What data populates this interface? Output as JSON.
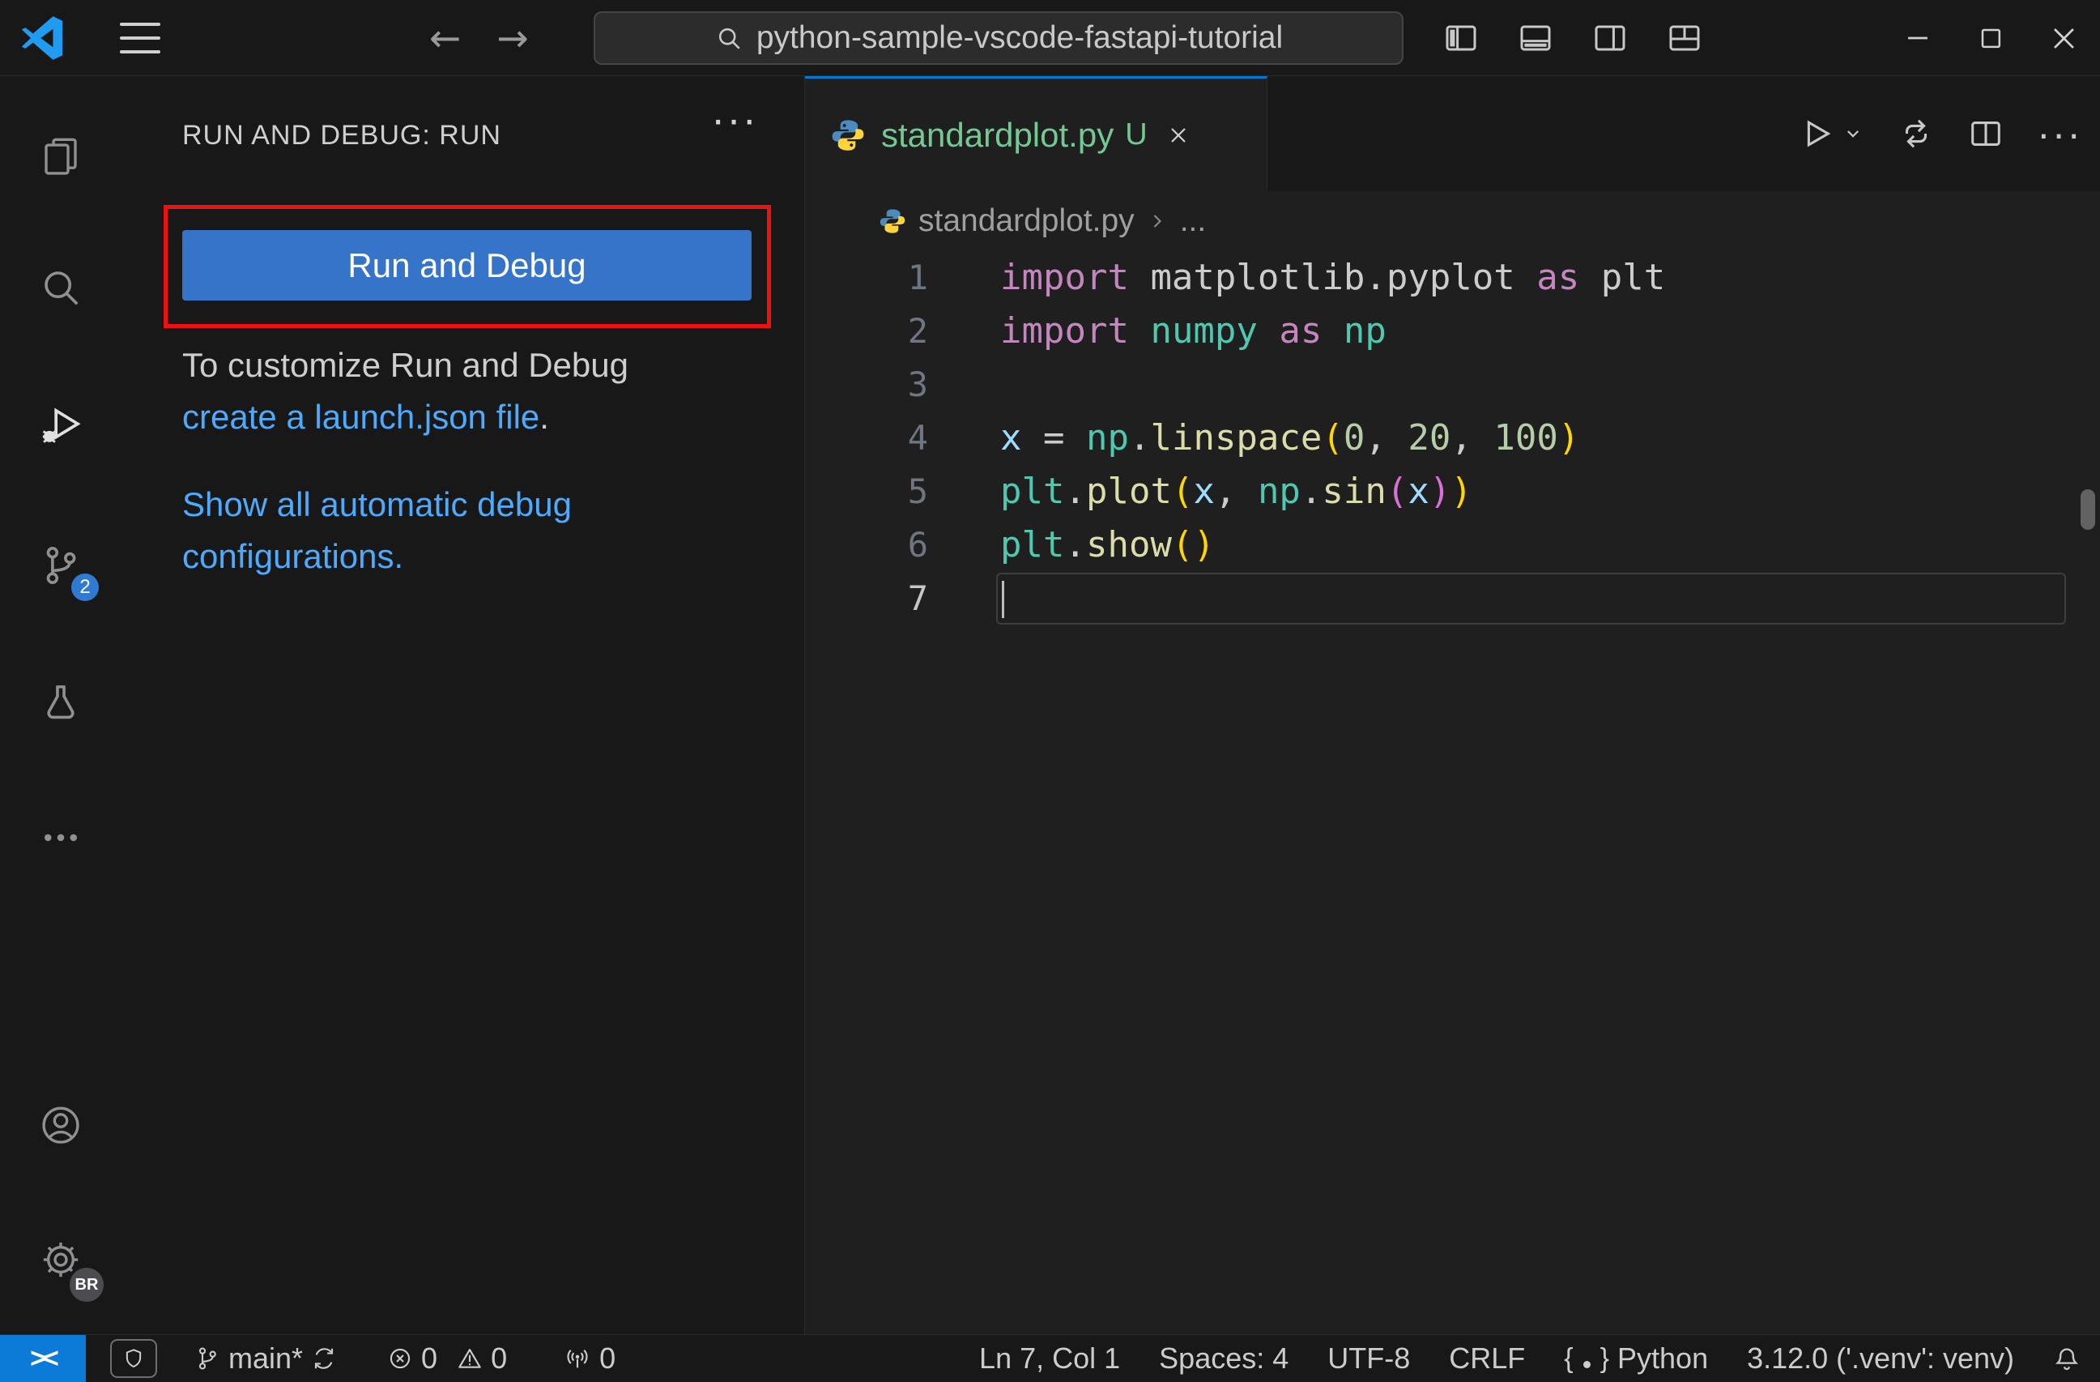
{
  "titlebar": {
    "search_text": "python-sample-vscode-fastapi-tutorial"
  },
  "icons": {
    "back": "←",
    "forward": "→",
    "more_dots": "···",
    "ellipsis": "···",
    "brace_open": "{",
    "brace_close": "}"
  },
  "activity_bar": {
    "scm_badge": "2",
    "profile_badge": "BR"
  },
  "sidebar": {
    "title": "RUN AND DEBUG: RUN",
    "run_button": "Run and Debug",
    "customize_prefix": "To customize Run and Debug ",
    "launch_link": "create a launch.json file",
    "customize_suffix": ".",
    "show_all_link": "Show all automatic debug configurations."
  },
  "editor": {
    "tab": {
      "name": "standardplot.py",
      "git_status": "U"
    },
    "breadcrumb": {
      "file": "standardplot.py",
      "more": "..."
    },
    "code_lines": [
      {
        "n": "1",
        "tokens": [
          [
            "import",
            "kw"
          ],
          [
            " matplotlib.pyplot ",
            "fg"
          ],
          [
            "as",
            "kw"
          ],
          [
            " plt",
            "fg"
          ]
        ]
      },
      {
        "n": "2",
        "tokens": [
          [
            "import",
            "kw"
          ],
          [
            " ",
            "fg"
          ],
          [
            "numpy",
            "mod"
          ],
          [
            " ",
            "fg"
          ],
          [
            "as",
            "kw"
          ],
          [
            " ",
            "fg"
          ],
          [
            "np",
            "mod"
          ]
        ]
      },
      {
        "n": "3",
        "tokens": []
      },
      {
        "n": "4",
        "tokens": [
          [
            "x",
            "var"
          ],
          [
            " = ",
            "fg"
          ],
          [
            "np",
            "mod"
          ],
          [
            ".",
            "fg"
          ],
          [
            "linspace",
            "fn"
          ],
          [
            "(",
            "b1"
          ],
          [
            "0",
            "num"
          ],
          [
            ", ",
            "fg"
          ],
          [
            "20",
            "num"
          ],
          [
            ", ",
            "fg"
          ],
          [
            "100",
            "num"
          ],
          [
            ")",
            "b1"
          ]
        ]
      },
      {
        "n": "5",
        "tokens": [
          [
            "plt",
            "mod"
          ],
          [
            ".",
            "fg"
          ],
          [
            "plot",
            "fn"
          ],
          [
            "(",
            "b1"
          ],
          [
            "x",
            "var"
          ],
          [
            ", ",
            "fg"
          ],
          [
            "np",
            "mod"
          ],
          [
            ".",
            "fg"
          ],
          [
            "sin",
            "fn"
          ],
          [
            "(",
            "b2"
          ],
          [
            "x",
            "var"
          ],
          [
            ")",
            "b2"
          ],
          [
            ")",
            "b1"
          ]
        ]
      },
      {
        "n": "6",
        "tokens": [
          [
            "plt",
            "mod"
          ],
          [
            ".",
            "fg"
          ],
          [
            "show",
            "fn"
          ],
          [
            "(",
            "b1"
          ],
          [
            ")",
            "b1"
          ]
        ]
      },
      {
        "n": "7",
        "tokens": [],
        "current": true
      }
    ]
  },
  "status_bar": {
    "remote_label": "><",
    "branch": "main*",
    "errors": "0",
    "warnings": "0",
    "ports": "0",
    "line_col": "Ln 7, Col 1",
    "spaces": "Spaces: 4",
    "encoding": "UTF-8",
    "eol": "CRLF",
    "language": "Python",
    "interpreter": "3.12.0 ('.venv': venv)"
  },
  "colors": {
    "chrome": "#181818",
    "editor": "#1f1f1f",
    "border": "#2b2b2b",
    "fg": "#cccccc",
    "accent": "#0078d4",
    "button": "#3574c9",
    "link": "#4daafc",
    "badge": "#2f7bd4",
    "remote": "#0c7bd8",
    "highlight_red": "#ee1111",
    "untracked_green": "#73c991",
    "line_number": "#6e7681",
    "tok_kw": "#C586C0",
    "tok_mod": "#4EC9B0",
    "tok_fn": "#DCDCAA",
    "tok_var": "#9CDCFE",
    "tok_num": "#B5CEA8",
    "tok_b1": "#FFD700",
    "tok_b2": "#DA70D6"
  }
}
